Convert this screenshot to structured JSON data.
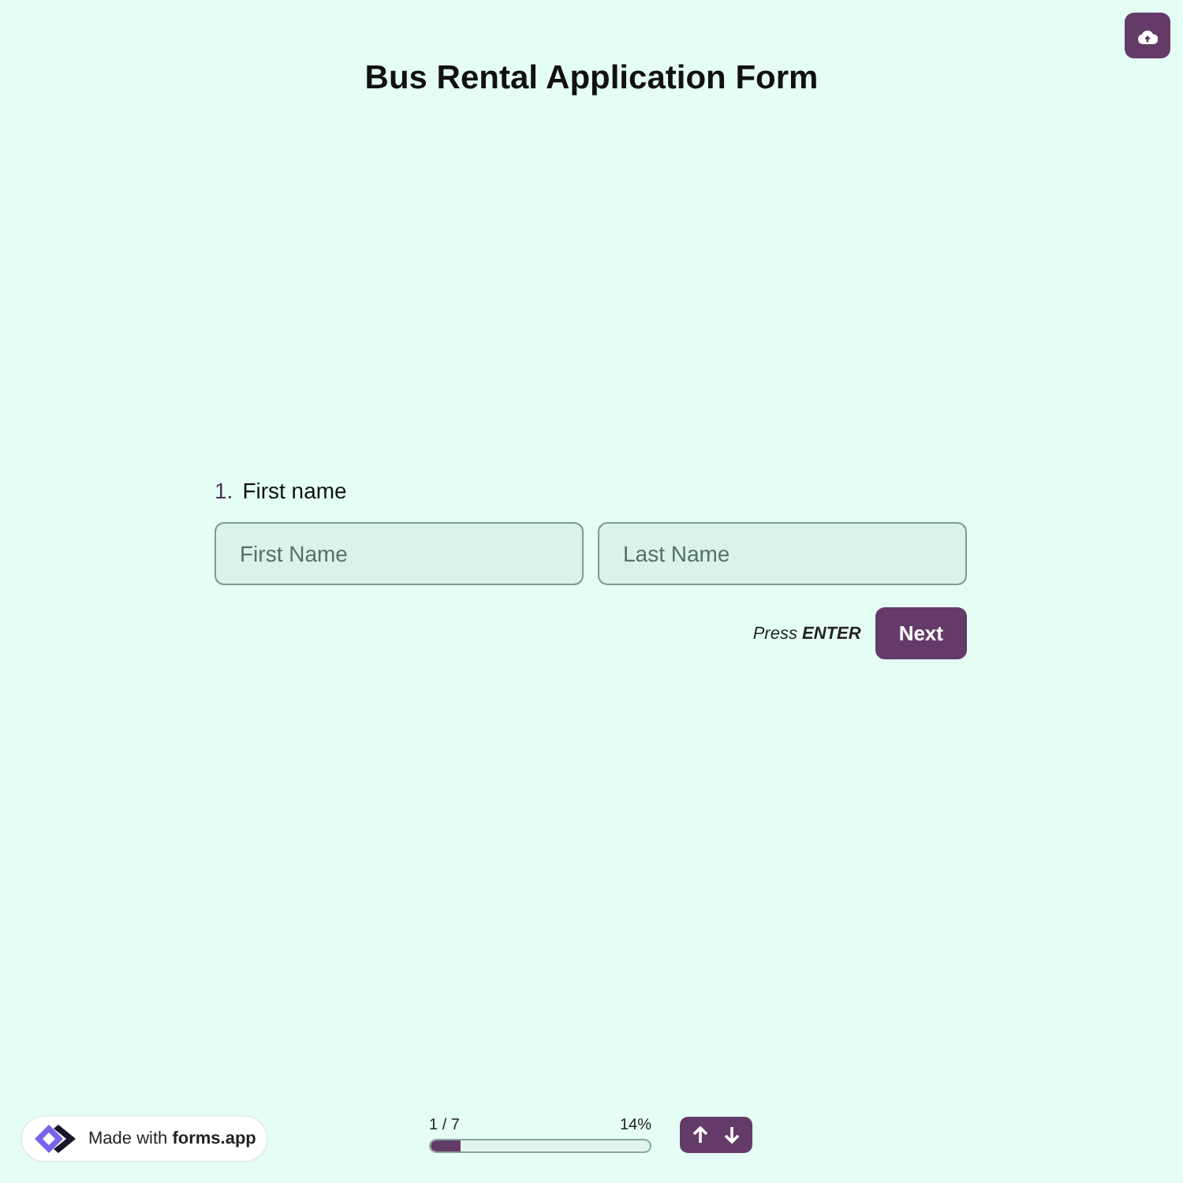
{
  "header": {
    "title": "Bus Rental Application Form"
  },
  "question": {
    "number": "1.",
    "label": "First name",
    "fields": [
      {
        "placeholder": "First Name"
      },
      {
        "placeholder": "Last Name"
      }
    ],
    "hint": "Press **ENTER**",
    "button": "Next"
  },
  "footer": {
    "badge": "Made with **forms.app**",
    "progress": {
      "count": "1 / 7",
      "percent": "14%",
      "level": 0.14
    }
  }
}
